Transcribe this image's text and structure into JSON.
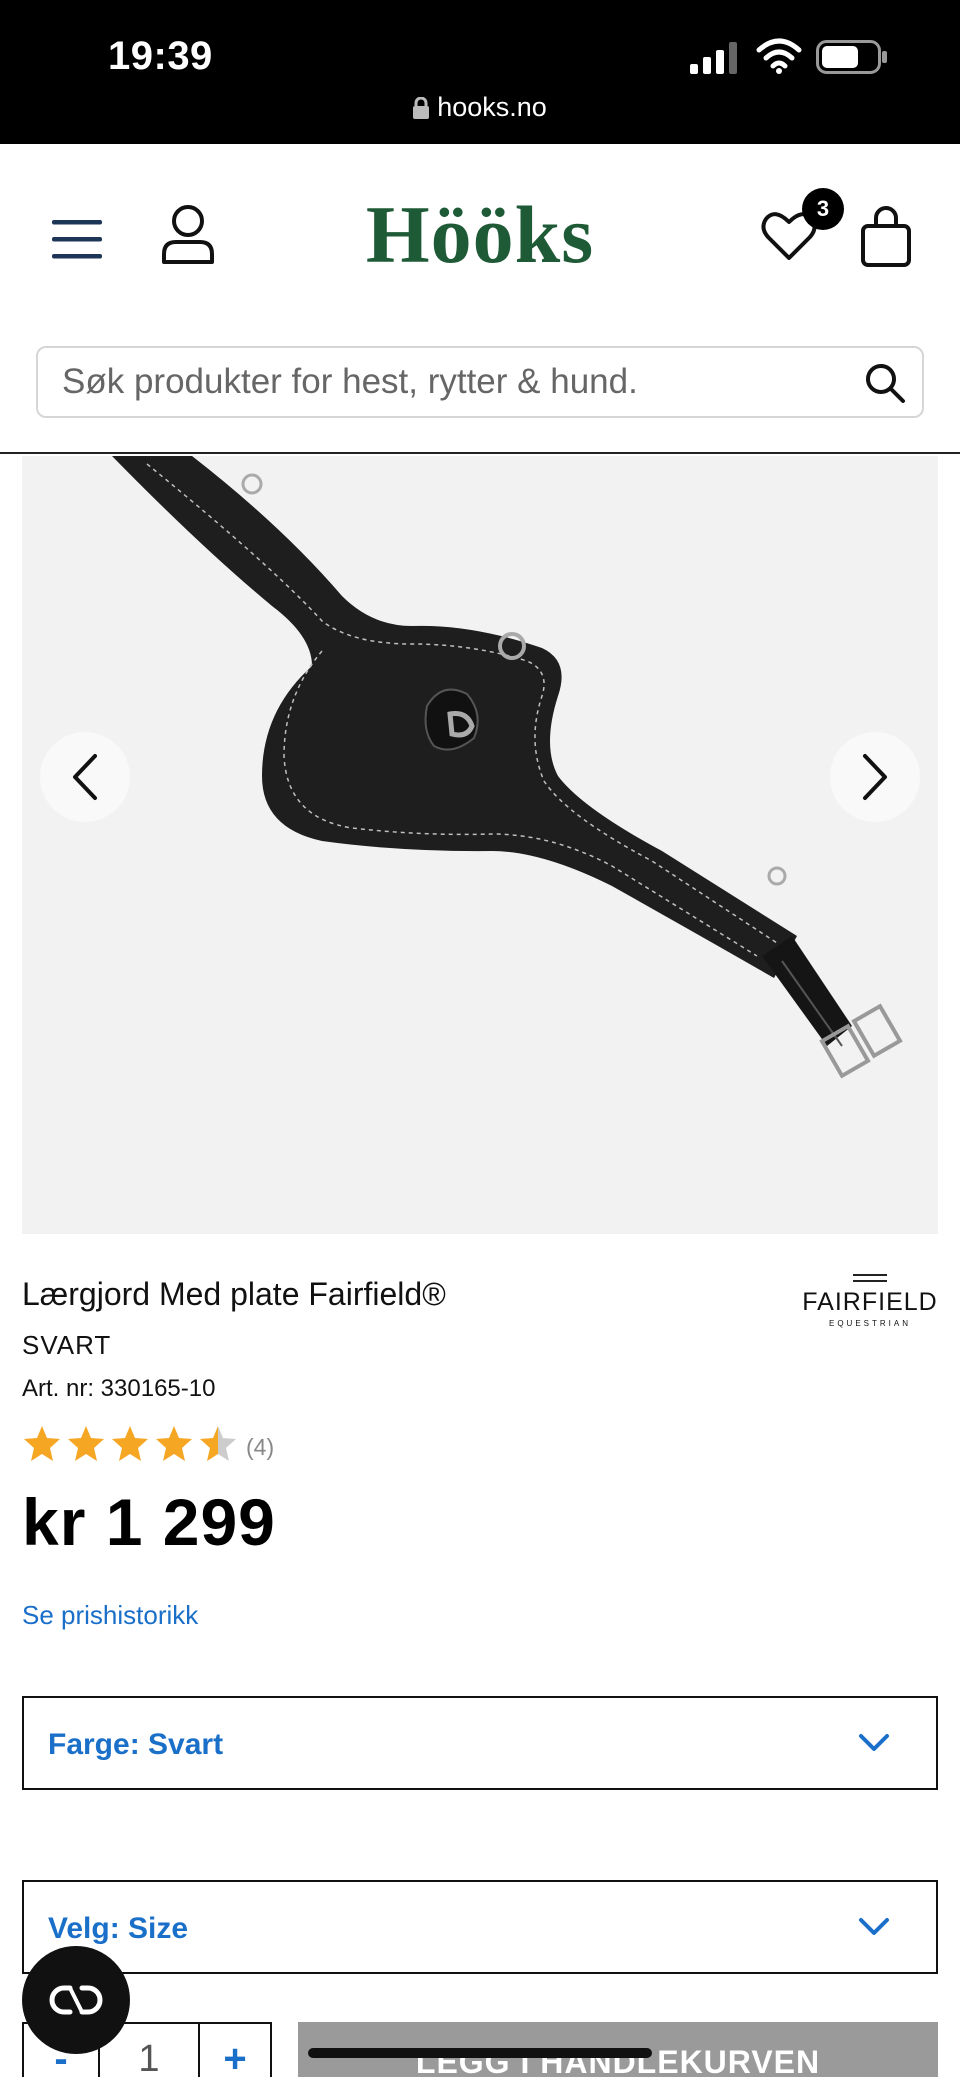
{
  "status_bar": {
    "time": "19:39",
    "url": "hooks.no",
    "icons": [
      "signal-icon",
      "wifi-icon",
      "battery-icon",
      "lock-icon"
    ]
  },
  "header": {
    "logo": "Hööks",
    "favorites_count": "3",
    "icons": [
      "menu-icon",
      "user-icon",
      "heart-icon",
      "shopping-bag-icon"
    ],
    "brand_color": "#1e5a36"
  },
  "search": {
    "placeholder": "Søk produkter for hest, rytter & hund.",
    "value": ""
  },
  "product": {
    "title": "Lærgjord Med plate Fairfield®",
    "color": "SVART",
    "article_number": "Art. nr: 330165-10",
    "rating": 4.5,
    "rating_max": 5,
    "review_count": "(4)",
    "price": "kr 1 299",
    "price_history_link": "Se prishistorikk",
    "brand": {
      "name": "FAIRFIELD",
      "sub": "EQUESTRIAN"
    }
  },
  "selectors": {
    "farge": "Farge: Svart",
    "size": "Velg: Size"
  },
  "cart": {
    "minus": "-",
    "quantity": "1",
    "plus": "+",
    "add_to_cart": "LEGG I HANDLEKURVEN"
  },
  "colors": {
    "link": "#1a6fc9",
    "star": "#f5a623",
    "star_empty": "#cccccc"
  }
}
